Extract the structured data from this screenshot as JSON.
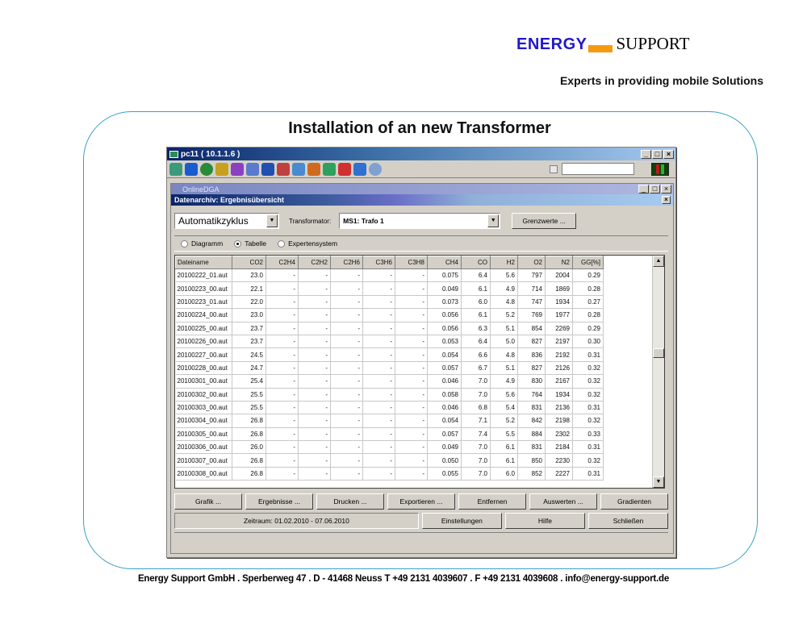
{
  "slide": {
    "logo_energy": "ENERGY",
    "logo_support": "SUPPORT",
    "tagline": "Experts in providing mobile Solutions",
    "title": "Installation of an new Transformer",
    "footer": "Energy Support GmbH  .  Sperberweg 47  .  D - 41468 Neuss   T +49 2131 4039607    .  F +49 2131 4039608  .  info@energy-support.de"
  },
  "window": {
    "title": "pc11 ( 10.1.1.6 )",
    "inner_title": "OnlineDGA",
    "sub_title": "Datenarchiv: Ergebnisübersicht"
  },
  "controls": {
    "cycle_value": "Automatikzyklus",
    "transformer_label": "Transformator:",
    "transformer_value": "MS1: Trafo 1",
    "limits_button": "Grenzwerte ...",
    "radios": [
      {
        "label": "Diagramm",
        "selected": false
      },
      {
        "label": "Tabelle",
        "selected": true
      },
      {
        "label": "Expertensystem",
        "selected": false
      }
    ]
  },
  "table": {
    "columns": [
      "Dateiname",
      "CO2",
      "C2H4",
      "C2H2",
      "C2H6",
      "C3H6",
      "C3H8",
      "CH4",
      "CO",
      "H2",
      "O2",
      "N2",
      "GG[%]"
    ],
    "rows": [
      [
        "20100222_01.aut",
        "23.0",
        "-",
        "-",
        "-",
        "-",
        "-",
        "0.075",
        "6.4",
        "5.6",
        "797",
        "2004",
        "0.29"
      ],
      [
        "20100223_00.aut",
        "22.1",
        "-",
        "-",
        "-",
        "-",
        "-",
        "0.049",
        "6.1",
        "4.9",
        "714",
        "1869",
        "0.28"
      ],
      [
        "20100223_01.aut",
        "22.0",
        "-",
        "-",
        "-",
        "-",
        "-",
        "0.073",
        "6.0",
        "4.8",
        "747",
        "1934",
        "0.27"
      ],
      [
        "20100224_00.aut",
        "23.0",
        "-",
        "-",
        "-",
        "-",
        "-",
        "0.056",
        "6.1",
        "5.2",
        "769",
        "1977",
        "0.28"
      ],
      [
        "20100225_00.aut",
        "23.7",
        "-",
        "-",
        "-",
        "-",
        "-",
        "0.056",
        "6.3",
        "5.1",
        "854",
        "2269",
        "0.29"
      ],
      [
        "20100226_00.aut",
        "23.7",
        "-",
        "-",
        "-",
        "-",
        "-",
        "0.053",
        "6.4",
        "5.0",
        "827",
        "2197",
        "0.30"
      ],
      [
        "20100227_00.aut",
        "24.5",
        "-",
        "-",
        "-",
        "-",
        "-",
        "0.054",
        "6.6",
        "4.8",
        "836",
        "2192",
        "0.31"
      ],
      [
        "20100228_00.aut",
        "24.7",
        "-",
        "-",
        "-",
        "-",
        "-",
        "0.057",
        "6.7",
        "5.1",
        "827",
        "2126",
        "0.32"
      ],
      [
        "20100301_00.aut",
        "25.4",
        "-",
        "-",
        "-",
        "-",
        "-",
        "0.046",
        "7.0",
        "4.9",
        "830",
        "2167",
        "0.32"
      ],
      [
        "20100302_00.aut",
        "25.5",
        "-",
        "-",
        "-",
        "-",
        "-",
        "0.058",
        "7.0",
        "5.6",
        "764",
        "1934",
        "0.32"
      ],
      [
        "20100303_00.aut",
        "25.5",
        "-",
        "-",
        "-",
        "-",
        "-",
        "0.046",
        "6.8",
        "5.4",
        "831",
        "2136",
        "0.31"
      ],
      [
        "20100304_00.aut",
        "26.8",
        "-",
        "-",
        "-",
        "-",
        "-",
        "0.054",
        "7.1",
        "5.2",
        "842",
        "2198",
        "0.32"
      ],
      [
        "20100305_00.aut",
        "26.8",
        "-",
        "-",
        "-",
        "-",
        "-",
        "0.057",
        "7.4",
        "5.5",
        "884",
        "2302",
        "0.33"
      ],
      [
        "20100306_00.aut",
        "26.0",
        "-",
        "-",
        "-",
        "-",
        "-",
        "0.049",
        "7.0",
        "6.1",
        "831",
        "2184",
        "0.31"
      ],
      [
        "20100307_00.aut",
        "26.8",
        "-",
        "-",
        "-",
        "-",
        "-",
        "0.050",
        "7.0",
        "6.1",
        "850",
        "2230",
        "0.32"
      ],
      [
        "20100308_00.aut",
        "26.8",
        "-",
        "-",
        "-",
        "-",
        "-",
        "0.055",
        "7.0",
        "6.0",
        "852",
        "2227",
        "0.31"
      ]
    ]
  },
  "buttons_row1": [
    "Grafik ...",
    "Ergebnisse ...",
    "Drucken ...",
    "Exportieren ...",
    "Entfernen",
    "Auswerten ...",
    "Gradienten"
  ],
  "status": {
    "period": "Zeitraum: 01.02.2010 - 07.06.2010"
  },
  "buttons_row2": [
    "Einstellungen",
    "Hilfe",
    "Schließen"
  ],
  "colors": {
    "logo_blue": "#2218c8",
    "logo_orange": "#f59a0f",
    "frame": "#3aa0c8",
    "win_face": "#d4d0c8"
  }
}
